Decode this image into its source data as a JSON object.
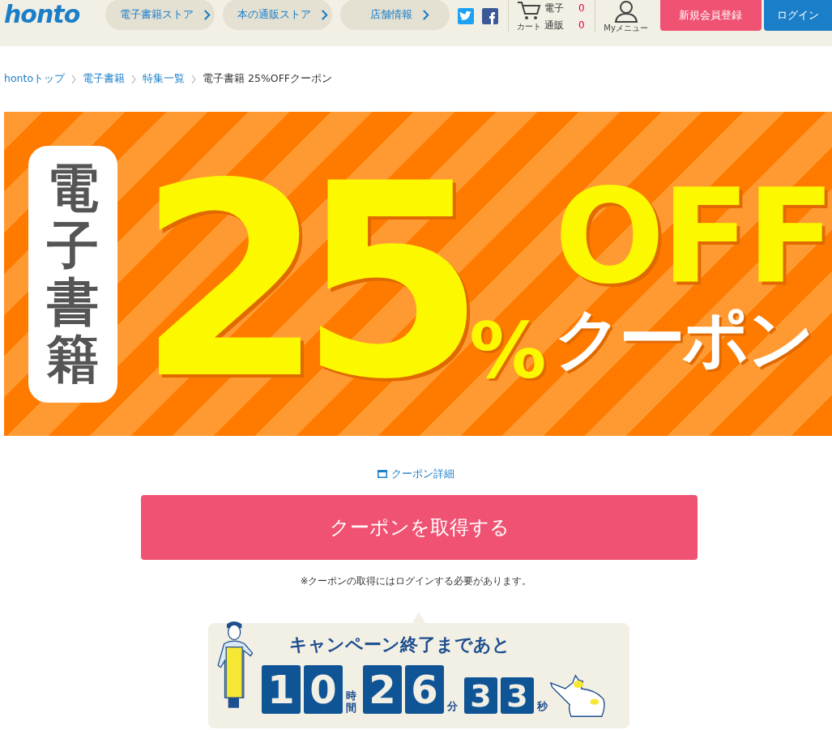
{
  "header": {
    "logo": "honto",
    "nav": [
      "電子書籍ストア",
      "本の通販ストア",
      "店舗情報"
    ],
    "cart": {
      "caption": "カート",
      "rows": [
        {
          "label": "電子",
          "count": "0"
        },
        {
          "label": "通販",
          "count": "0"
        }
      ]
    },
    "my_menu": "Myメニュー",
    "register": "新規会員登録",
    "login": "ログイン"
  },
  "breadcrumb": [
    {
      "label": "hontoトップ",
      "link": true
    },
    {
      "label": "電子書籍",
      "link": true
    },
    {
      "label": "特集一覧",
      "link": true
    },
    {
      "label": "電子書籍 25%OFFクーポン",
      "link": false
    }
  ],
  "banner": {
    "side": "電子書籍",
    "number": "25",
    "percent": "%",
    "off": "OFF",
    "coupon": "クーポン"
  },
  "coupon_detail": "クーポン詳細",
  "get_button": "クーポンを取得する",
  "note": "※クーポンの取得にはログインする必要があります。",
  "countdown": {
    "title": "キャンペーン終了まであと",
    "units": [
      {
        "digits": [
          "1",
          "0"
        ],
        "label": "時間"
      },
      {
        "digits": [
          "2",
          "6"
        ],
        "label": "分"
      },
      {
        "digits": [
          "3",
          "3"
        ],
        "label": "秒"
      }
    ]
  }
}
